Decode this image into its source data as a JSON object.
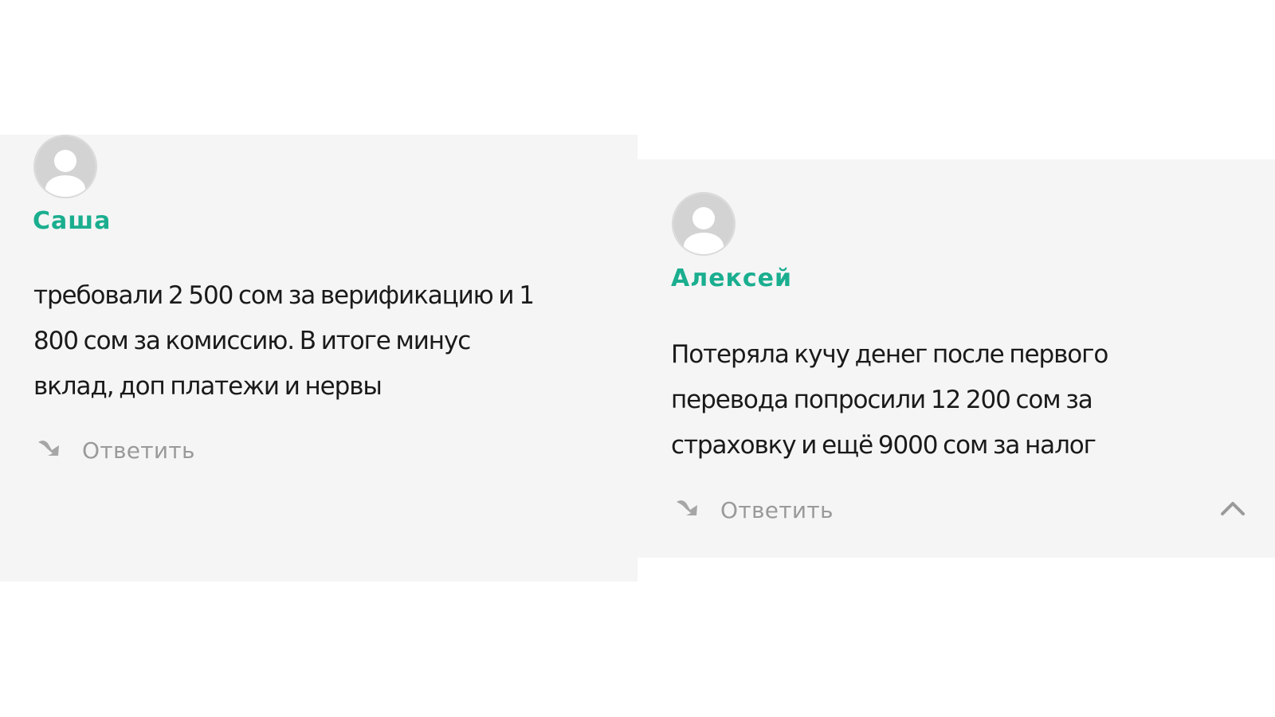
{
  "colors": {
    "accent": "#1aae8f",
    "card_background": "#f5f5f5",
    "text": "#1a1a1a",
    "muted": "#9a9a9a"
  },
  "comments": [
    {
      "author": "Саша",
      "text_lines": [
        "требовали 2 500 сом за верификацию и 1",
        "800 сом за комиссию. В итоге минус",
        "вклад, доп платежи и нервы"
      ],
      "reply_label": "Ответить",
      "avatar_icon": "user-avatar-icon",
      "reply_icon": "reply-arrow-icon"
    },
    {
      "author": "Алексей",
      "text_lines": [
        "Потеряла кучу денег после первого",
        "перевода попросили 12 200 сом за",
        "страховку и ещё 9000 сом за налог"
      ],
      "reply_label": "Ответить",
      "avatar_icon": "user-avatar-icon",
      "reply_icon": "reply-arrow-icon"
    }
  ],
  "scroll_top_icon": "chevron-up-icon"
}
